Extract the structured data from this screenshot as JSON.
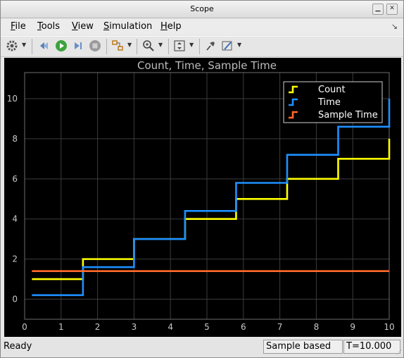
{
  "window": {
    "title": "Scope"
  },
  "menu": {
    "items": [
      {
        "label": "File",
        "key": "F",
        "rest": "ile"
      },
      {
        "label": "Tools",
        "key": "T",
        "rest": "ools"
      },
      {
        "label": "View",
        "key": "V",
        "rest": "iew"
      },
      {
        "label": "Simulation",
        "key": "S",
        "rest": "imulation"
      },
      {
        "label": "Help",
        "key": "H",
        "rest": "elp"
      }
    ],
    "dock_icon": "undock-arrow-icon"
  },
  "toolbar": {
    "buttons": [
      "settings-icon",
      "step-back-icon",
      "run-icon",
      "step-forward-icon",
      "stop-icon",
      "highlight-block-icon",
      "zoom-in-icon",
      "scale-axes-icon",
      "pin-icon",
      "measurement-icon"
    ]
  },
  "chart_data": {
    "type": "line",
    "title": "Count, Time, Sample Time",
    "xlabel": "",
    "ylabel": "",
    "xlim": [
      0,
      10
    ],
    "ylim": [
      -1,
      11.3
    ],
    "xticks": [
      0,
      1,
      2,
      3,
      4,
      5,
      6,
      7,
      8,
      9,
      10
    ],
    "yticks": [
      0,
      2,
      4,
      6,
      8,
      10
    ],
    "grid": true,
    "legend_position": "top-right",
    "background": "#000000",
    "series": [
      {
        "name": "Count",
        "color": "#ffff00",
        "step": true,
        "x": [
          0.2,
          1.6,
          3.0,
          4.4,
          5.8,
          7.2,
          8.6,
          10.0
        ],
        "y": [
          1,
          2,
          3,
          4,
          5,
          6,
          7,
          8
        ]
      },
      {
        "name": "Time",
        "color": "#1e90ff",
        "step": true,
        "x": [
          0.2,
          1.6,
          3.0,
          4.4,
          5.8,
          7.2,
          8.6,
          10.0
        ],
        "y": [
          0.2,
          1.6,
          3.0,
          4.4,
          5.8,
          7.2,
          8.6,
          10.0
        ]
      },
      {
        "name": "Sample Time",
        "color": "#ff6a2a",
        "step": true,
        "x": [
          0.2,
          10.0
        ],
        "y": [
          1.4,
          1.4
        ]
      }
    ]
  },
  "status": {
    "ready": "Ready",
    "mode": "Sample based",
    "time": "T=10.000"
  }
}
